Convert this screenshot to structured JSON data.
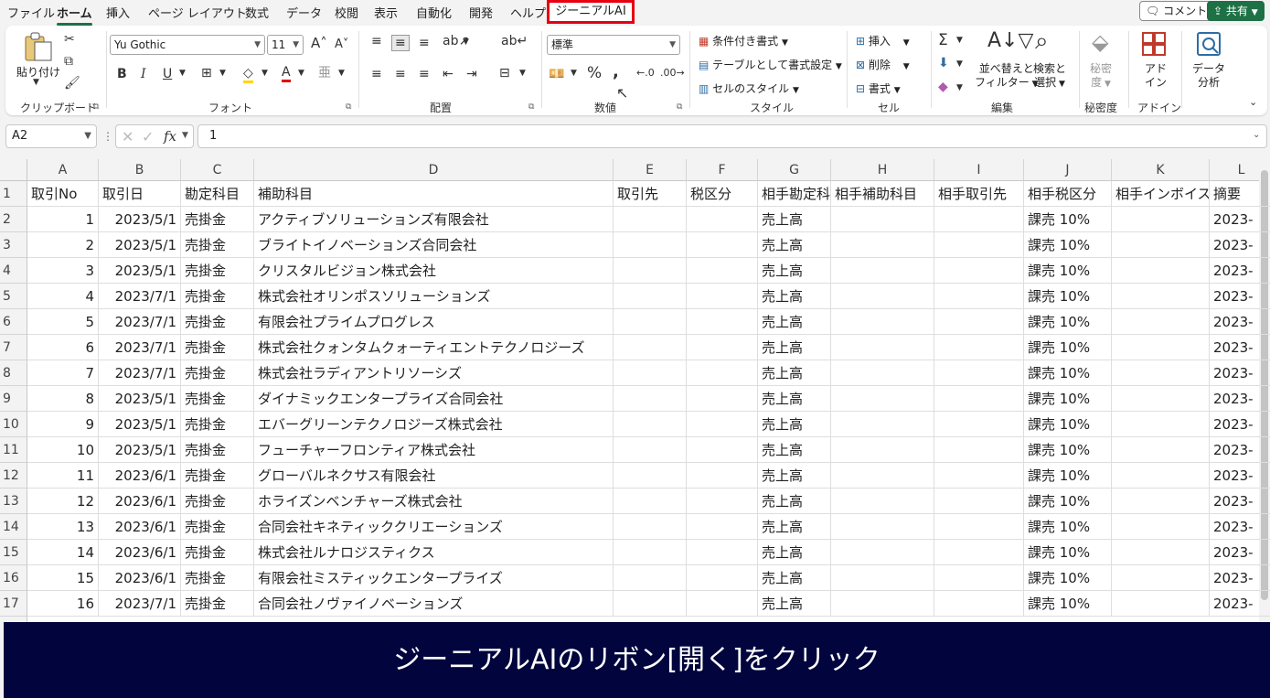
{
  "menu": {
    "tabs": [
      "ファイル",
      "ホーム",
      "挿入",
      "ページ レイアウト",
      "数式",
      "データ",
      "校閲",
      "表示",
      "自動化",
      "開発",
      "ヘルプ"
    ],
    "active_tab": "ホーム",
    "highlighted_tab": "ジーニアルAI",
    "comment_label": "コメント",
    "share_label": "共有"
  },
  "ribbon": {
    "clipboard": {
      "paste_label": "貼り付け",
      "group": "クリップボード"
    },
    "font": {
      "name": "Yu Gothic",
      "size": "11",
      "group": "フォント"
    },
    "alignment": {
      "group": "配置"
    },
    "number": {
      "format": "標準",
      "group": "数値"
    },
    "styles": {
      "conditional": "条件付き書式",
      "table": "テーブルとして書式設定",
      "cell_styles": "セルのスタイル",
      "group": "スタイル"
    },
    "cells": {
      "insert": "挿入",
      "delete": "削除",
      "format": "書式",
      "group": "セル"
    },
    "editing": {
      "sort_line1": "並べ替えと",
      "sort_line2": "フィルター",
      "find_line1": "検索と",
      "find_line2": "選択",
      "group": "編集"
    },
    "sensitivity": {
      "line1": "秘密",
      "line2": "度",
      "group": "秘密度"
    },
    "addins": {
      "line1": "アド",
      "line2": "イン",
      "group": "アドイン"
    },
    "analyze": {
      "line1": "データ",
      "line2": "分析"
    }
  },
  "formula_bar": {
    "name_box": "A2",
    "value": "1"
  },
  "sheet": {
    "columns": [
      "A",
      "B",
      "C",
      "D",
      "E",
      "F",
      "G",
      "H",
      "I",
      "J",
      "K",
      "L"
    ],
    "header_row": [
      "取引No",
      "取引日",
      "勘定科目",
      "補助科目",
      "取引先",
      "税区分",
      "相手勘定科",
      "相手補助科目",
      "相手取引先",
      "相手税区分",
      "相手インボイス",
      "摘要"
    ],
    "rows": [
      {
        "no": "1",
        "date": "2023/5/1",
        "account": "売掛金",
        "sub": "アクティブソリューションズ有限会社",
        "partner": "",
        "tax": "",
        "c_account": "売上高",
        "c_sub": "",
        "c_partner": "",
        "c_tax": "課売 10%",
        "c_invoice": "",
        "memo": "2023-"
      },
      {
        "no": "2",
        "date": "2023/5/1",
        "account": "売掛金",
        "sub": "ブライトイノベーションズ合同会社",
        "partner": "",
        "tax": "",
        "c_account": "売上高",
        "c_sub": "",
        "c_partner": "",
        "c_tax": "課売 10%",
        "c_invoice": "",
        "memo": "2023-"
      },
      {
        "no": "3",
        "date": "2023/5/1",
        "account": "売掛金",
        "sub": "クリスタルビジョン株式会社",
        "partner": "",
        "tax": "",
        "c_account": "売上高",
        "c_sub": "",
        "c_partner": "",
        "c_tax": "課売 10%",
        "c_invoice": "",
        "memo": "2023-"
      },
      {
        "no": "4",
        "date": "2023/7/1",
        "account": "売掛金",
        "sub": "株式会社オリンポスソリューションズ",
        "partner": "",
        "tax": "",
        "c_account": "売上高",
        "c_sub": "",
        "c_partner": "",
        "c_tax": "課売 10%",
        "c_invoice": "",
        "memo": "2023-"
      },
      {
        "no": "5",
        "date": "2023/7/1",
        "account": "売掛金",
        "sub": "有限会社プライムプログレス",
        "partner": "",
        "tax": "",
        "c_account": "売上高",
        "c_sub": "",
        "c_partner": "",
        "c_tax": "課売 10%",
        "c_invoice": "",
        "memo": "2023-"
      },
      {
        "no": "6",
        "date": "2023/7/1",
        "account": "売掛金",
        "sub": "株式会社クォンタムクォーティエントテクノロジーズ",
        "partner": "",
        "tax": "",
        "c_account": "売上高",
        "c_sub": "",
        "c_partner": "",
        "c_tax": "課売 10%",
        "c_invoice": "",
        "memo": "2023-"
      },
      {
        "no": "7",
        "date": "2023/7/1",
        "account": "売掛金",
        "sub": "株式会社ラディアントリソーシズ",
        "partner": "",
        "tax": "",
        "c_account": "売上高",
        "c_sub": "",
        "c_partner": "",
        "c_tax": "課売 10%",
        "c_invoice": "",
        "memo": "2023-"
      },
      {
        "no": "8",
        "date": "2023/5/1",
        "account": "売掛金",
        "sub": "ダイナミックエンタープライズ合同会社",
        "partner": "",
        "tax": "",
        "c_account": "売上高",
        "c_sub": "",
        "c_partner": "",
        "c_tax": "課売 10%",
        "c_invoice": "",
        "memo": "2023-"
      },
      {
        "no": "9",
        "date": "2023/5/1",
        "account": "売掛金",
        "sub": "エバーグリーンテクノロジーズ株式会社",
        "partner": "",
        "tax": "",
        "c_account": "売上高",
        "c_sub": "",
        "c_partner": "",
        "c_tax": "課売 10%",
        "c_invoice": "",
        "memo": "2023-"
      },
      {
        "no": "10",
        "date": "2023/5/1",
        "account": "売掛金",
        "sub": "フューチャーフロンティア株式会社",
        "partner": "",
        "tax": "",
        "c_account": "売上高",
        "c_sub": "",
        "c_partner": "",
        "c_tax": "課売 10%",
        "c_invoice": "",
        "memo": "2023-"
      },
      {
        "no": "11",
        "date": "2023/6/1",
        "account": "売掛金",
        "sub": "グローバルネクサス有限会社",
        "partner": "",
        "tax": "",
        "c_account": "売上高",
        "c_sub": "",
        "c_partner": "",
        "c_tax": "課売 10%",
        "c_invoice": "",
        "memo": "2023-"
      },
      {
        "no": "12",
        "date": "2023/6/1",
        "account": "売掛金",
        "sub": "ホライズンベンチャーズ株式会社",
        "partner": "",
        "tax": "",
        "c_account": "売上高",
        "c_sub": "",
        "c_partner": "",
        "c_tax": "課売 10%",
        "c_invoice": "",
        "memo": "2023-"
      },
      {
        "no": "13",
        "date": "2023/6/1",
        "account": "売掛金",
        "sub": "合同会社キネティッククリエーションズ",
        "partner": "",
        "tax": "",
        "c_account": "売上高",
        "c_sub": "",
        "c_partner": "",
        "c_tax": "課売 10%",
        "c_invoice": "",
        "memo": "2023-"
      },
      {
        "no": "14",
        "date": "2023/6/1",
        "account": "売掛金",
        "sub": "株式会社ルナロジスティクス",
        "partner": "",
        "tax": "",
        "c_account": "売上高",
        "c_sub": "",
        "c_partner": "",
        "c_tax": "課売 10%",
        "c_invoice": "",
        "memo": "2023-"
      },
      {
        "no": "15",
        "date": "2023/6/1",
        "account": "売掛金",
        "sub": "有限会社ミスティックエンタープライズ",
        "partner": "",
        "tax": "",
        "c_account": "売上高",
        "c_sub": "",
        "c_partner": "",
        "c_tax": "課売 10%",
        "c_invoice": "",
        "memo": "2023-"
      },
      {
        "no": "16",
        "date": "2023/7/1",
        "account": "売掛金",
        "sub": "合同会社ノヴァイノベーションズ",
        "partner": "",
        "tax": "",
        "c_account": "売上高",
        "c_sub": "",
        "c_partner": "",
        "c_tax": "課売 10%",
        "c_invoice": "",
        "memo": "2023-"
      }
    ]
  },
  "caption": "ジーニアルAIのリボン[開く]をクリック",
  "colors": {
    "accent": "#1e7145",
    "highlight_border": "#e60012",
    "caption_bg": "#02053d"
  }
}
